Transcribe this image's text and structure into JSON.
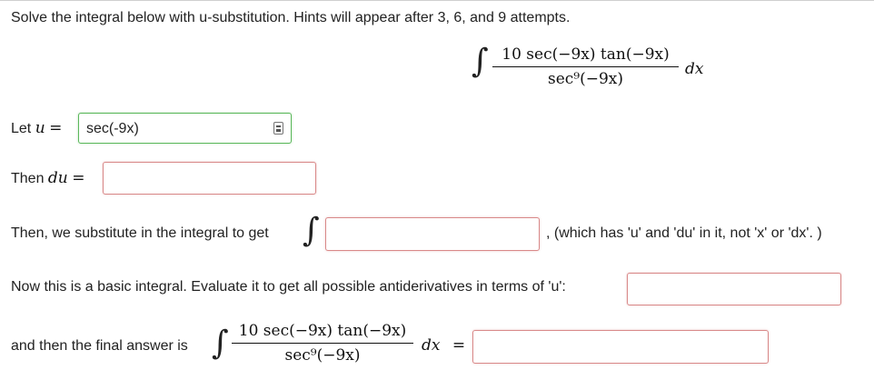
{
  "instructions": "Solve the integral below with u-substitution. Hints will appear after 3, 6, and 9 attempts.",
  "integral": {
    "numerator": "10 sec(−9x) tan(−9x)",
    "denominator": "sec⁹(−9x)",
    "differential": "dx"
  },
  "step_u": {
    "label_prefix": "Let",
    "var": "u",
    "eq": "=",
    "value": "sec(-9x)"
  },
  "step_du": {
    "label_prefix": "Then",
    "var": "du",
    "eq": "=",
    "value": ""
  },
  "step_substitute": {
    "label": "Then, we substitute in the integral to get",
    "suffix": ", (which has 'u' and 'du' in it, not 'x' or 'dx'. )",
    "value": ""
  },
  "step_basic": {
    "label": "Now this is a basic integral. Evaluate it to get all possible antiderivatives in terms of 'u':",
    "value": ""
  },
  "step_final": {
    "label": "and then the final answer is",
    "eq": "=",
    "value": ""
  }
}
